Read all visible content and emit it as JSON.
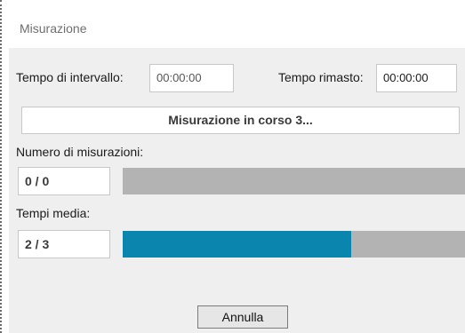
{
  "window": {
    "title": "Misurazione"
  },
  "interval": {
    "label": "Tempo di intervallo:",
    "value": "00:00:00"
  },
  "remaining": {
    "label": "Tempo rimasto:",
    "value": "00:00:00"
  },
  "status": {
    "text": "Misurazione in corso 3..."
  },
  "measurements": {
    "label": "Numero di misurazioni:",
    "count": "0 / 0",
    "progress": 0
  },
  "averages": {
    "label": "Tempi media:",
    "count": "2 / 3",
    "progress": 0.6667
  },
  "actions": {
    "cancel_label": "Annulla"
  },
  "colors": {
    "progress_fill": "#0a86ae",
    "progress_track": "#b3b3b3",
    "background": "#efefef"
  }
}
